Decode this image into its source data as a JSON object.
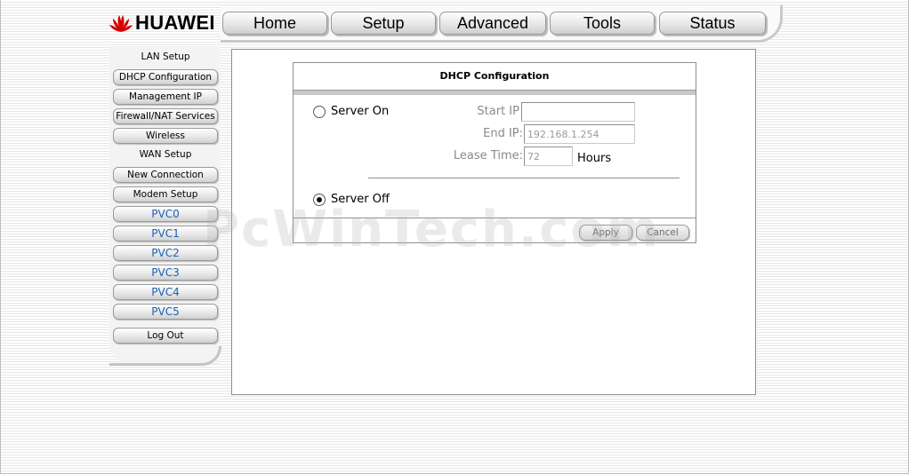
{
  "brand": {
    "name": "HUAWEI",
    "color": "#d40000"
  },
  "nav": {
    "tabs": [
      {
        "label": "Home"
      },
      {
        "label": "Setup"
      },
      {
        "label": "Advanced"
      },
      {
        "label": "Tools"
      },
      {
        "label": "Status"
      }
    ]
  },
  "sidebar": {
    "lan_header": "LAN Setup",
    "lan_items": [
      {
        "label": "DHCP Configuration"
      },
      {
        "label": "Management IP"
      },
      {
        "label": "Firewall/NAT Services"
      },
      {
        "label": "Wireless"
      }
    ],
    "wan_header": "WAN Setup",
    "wan_items": [
      {
        "label": "New Connection"
      },
      {
        "label": "Modem Setup"
      }
    ],
    "pvc_items": [
      {
        "label": "PVC0"
      },
      {
        "label": "PVC1"
      },
      {
        "label": "PVC2"
      },
      {
        "label": "PVC3"
      },
      {
        "label": "PVC4"
      },
      {
        "label": "PVC5"
      }
    ],
    "logout_label": "Log Out"
  },
  "dhcp": {
    "title": "DHCP Configuration",
    "server_on_label": "Server On",
    "server_off_label": "Server Off",
    "selected": "off",
    "start_ip_label": "Start IP",
    "start_ip_value": "",
    "end_ip_label": "End IP:",
    "end_ip_value": "192.168.1.254",
    "lease_time_label": "Lease Time:",
    "lease_time_value": "72",
    "hours_label": "Hours",
    "apply_label": "Apply",
    "cancel_label": "Cancel"
  },
  "watermark": "PcWinTech.com"
}
